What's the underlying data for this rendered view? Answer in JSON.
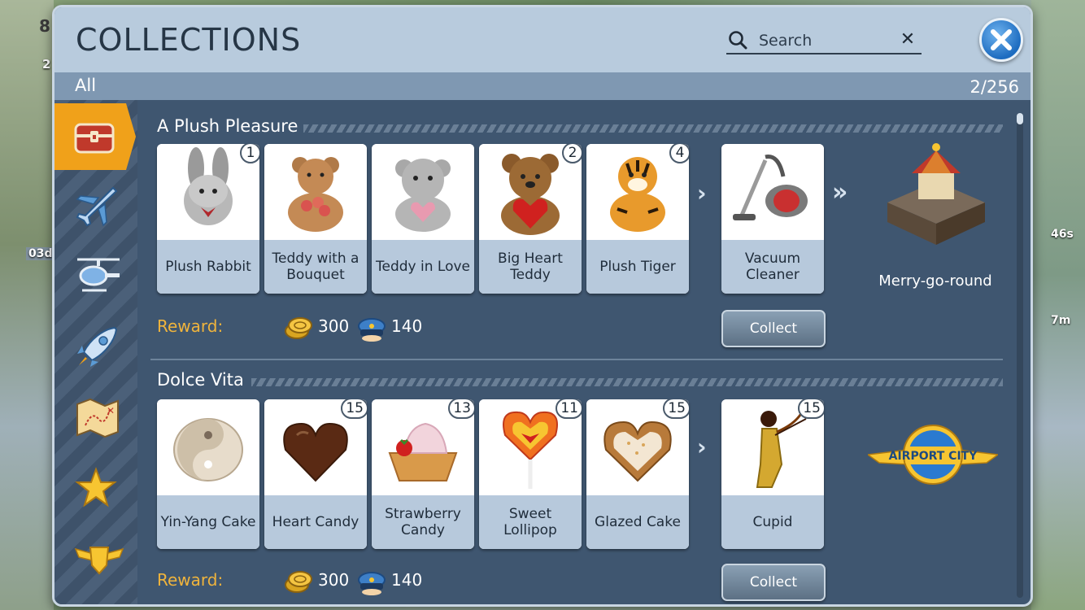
{
  "dialog": {
    "title": "COLLECTIONS",
    "search": {
      "placeholder": "Search"
    },
    "filter": "All",
    "count": "2/256"
  },
  "background": {
    "left_level": "8",
    "left_people": "2",
    "left_timer": "03d",
    "right_timer_1": "46s",
    "right_timer_2": "7m"
  },
  "sidebar": {
    "items": [
      {
        "icon": "treasure-chest-icon",
        "active": true
      },
      {
        "icon": "airplane-icon",
        "active": false
      },
      {
        "icon": "helicopter-icon",
        "active": false
      },
      {
        "icon": "rocket-icon",
        "active": false
      },
      {
        "icon": "treasure-map-icon",
        "active": false
      },
      {
        "icon": "star-icon",
        "active": false
      },
      {
        "icon": "winged-badge-icon",
        "active": false
      }
    ]
  },
  "collections": [
    {
      "title": "A Plush Pleasure",
      "items": [
        {
          "label": "Plush Rabbit",
          "count": "1"
        },
        {
          "label": "Teddy with a Bouquet",
          "count": ""
        },
        {
          "label": "Teddy in Love",
          "count": ""
        },
        {
          "label": "Big Heart Teddy",
          "count": "2"
        },
        {
          "label": "Plush Tiger",
          "count": "4"
        }
      ],
      "result": {
        "label": "Vacuum Cleaner",
        "count": ""
      },
      "prize": {
        "label": "Merry-go-round"
      },
      "reward": {
        "label": "Reward:",
        "coins": "300",
        "caps": "140"
      },
      "collect_label": "Collect"
    },
    {
      "title": "Dolce Vita",
      "items": [
        {
          "label": "Yin-Yang Cake",
          "count": ""
        },
        {
          "label": "Heart Candy",
          "count": "15"
        },
        {
          "label": "Strawberry Candy",
          "count": "13"
        },
        {
          "label": "Sweet Lollipop",
          "count": "11"
        },
        {
          "label": "Glazed Cake",
          "count": "15"
        }
      ],
      "result": {
        "label": "Cupid",
        "count": "15"
      },
      "prize": {
        "label": "AIRPORT CITY"
      },
      "reward": {
        "label": "Reward:",
        "coins": "300",
        "caps": "140"
      },
      "collect_label": "Collect"
    }
  ],
  "colors": {
    "accent": "#f0a11a",
    "reward_text": "#f0b43c",
    "panel": "#3f5670",
    "header": "#b8cbdd"
  }
}
